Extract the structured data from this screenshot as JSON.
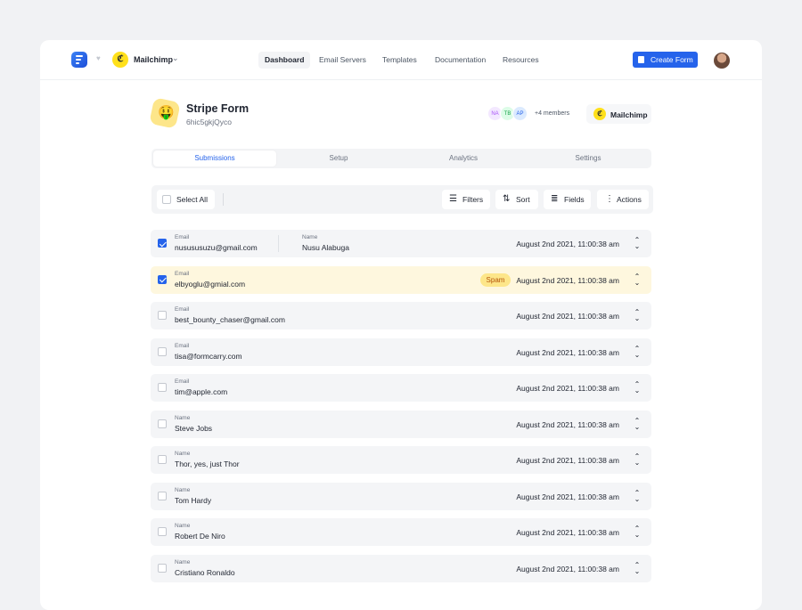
{
  "header": {
    "brand_name": "Mailchimp",
    "nav": [
      "Dashboard",
      "Email Servers",
      "Templates",
      "Documentation",
      "Resources"
    ],
    "active_nav": "Dashboard",
    "create_button": "Create Form"
  },
  "form": {
    "title": "Stripe Form",
    "id": "6hic5gkjQyco",
    "emoji": "🤑",
    "members": [
      "NA",
      "TB",
      "AP"
    ],
    "members_more": "+4 members",
    "integration": "Mailchimp"
  },
  "tabs": [
    "Submissions",
    "Setup",
    "Analytics",
    "Settings"
  ],
  "active_tab": "Submissions",
  "toolbar": {
    "select_all": "Select All",
    "filters": "Filters",
    "sort": "Sort",
    "fields": "Fields",
    "actions": "Actions"
  },
  "submissions": [
    {
      "checked": true,
      "field1_label": "Email",
      "field1_value": "nusususuzu@gmail.com",
      "field2_label": "Name",
      "field2_value": "Nusu Alabuga",
      "badge": "",
      "date": "August 2nd 2021, 11:00:38 am"
    },
    {
      "checked": true,
      "field1_label": "Email",
      "field1_value": "elbyoglu@gmial.com",
      "field2_label": "",
      "field2_value": "",
      "badge": "Spam",
      "date": "August 2nd 2021, 11:00:38 am"
    },
    {
      "checked": false,
      "field1_label": "Email",
      "field1_value": "best_bounty_chaser@gmail.com",
      "field2_label": "",
      "field2_value": "",
      "badge": "",
      "date": "August 2nd 2021, 11:00:38 am"
    },
    {
      "checked": false,
      "field1_label": "Email",
      "field1_value": "tisa@formcarry.com",
      "field2_label": "",
      "field2_value": "",
      "badge": "",
      "date": "August 2nd 2021, 11:00:38 am"
    },
    {
      "checked": false,
      "field1_label": "Email",
      "field1_value": "tim@apple.com",
      "field2_label": "",
      "field2_value": "",
      "badge": "",
      "date": "August 2nd 2021, 11:00:38 am"
    },
    {
      "checked": false,
      "field1_label": "Name",
      "field1_value": "Steve Jobs",
      "field2_label": "",
      "field2_value": "",
      "badge": "",
      "date": "August 2nd 2021, 11:00:38 am"
    },
    {
      "checked": false,
      "field1_label": "Name",
      "field1_value": "Thor, yes, just Thor",
      "field2_label": "",
      "field2_value": "",
      "badge": "",
      "date": "August 2nd 2021, 11:00:38 am"
    },
    {
      "checked": false,
      "field1_label": "Name",
      "field1_value": "Tom Hardy",
      "field2_label": "",
      "field2_value": "",
      "badge": "",
      "date": "August 2nd 2021, 11:00:38 am"
    },
    {
      "checked": false,
      "field1_label": "Name",
      "field1_value": "Robert De Niro",
      "field2_label": "",
      "field2_value": "",
      "badge": "",
      "date": "August 2nd 2021, 11:00:38 am"
    },
    {
      "checked": false,
      "field1_label": "Name",
      "field1_value": "Cristiano Ronaldo",
      "field2_label": "",
      "field2_value": "",
      "badge": "",
      "date": "August 2nd 2021, 11:00:38 am"
    }
  ],
  "colors": {
    "accent": "#2563eb",
    "spam_row": "#fef7de",
    "spam_badge": "#fde68a"
  },
  "icons": [
    "app-logo-icon",
    "heart-icon",
    "mailchimp-icon",
    "chevron-down-icon",
    "form-icon",
    "filter-icon",
    "sort-icon",
    "list-icon",
    "more-vertical-icon",
    "expand-icon"
  ]
}
